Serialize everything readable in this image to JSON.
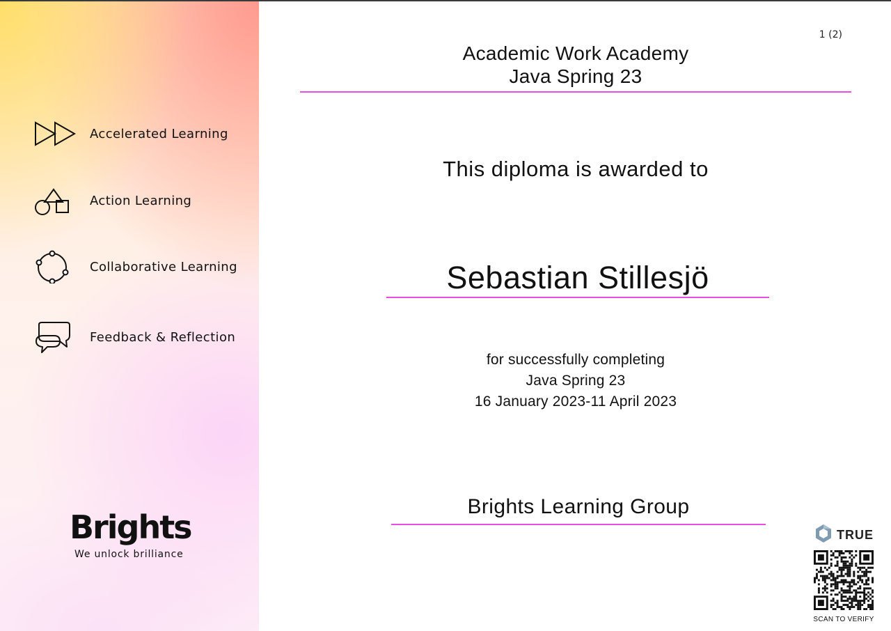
{
  "page_number": "1 (2)",
  "sidebar": {
    "features": [
      {
        "icon": "fast-forward-icon",
        "label": "Accelerated Learning"
      },
      {
        "icon": "shapes-icon",
        "label": "Action Learning"
      },
      {
        "icon": "circle-nodes-icon",
        "label": "Collaborative Learning"
      },
      {
        "icon": "speech-bubbles-icon",
        "label": "Feedback & Reflection"
      }
    ],
    "brand": "Brights",
    "tagline": "We unlock brilliance"
  },
  "diploma": {
    "academy": "Academic Work Academy",
    "program": "Java Spring 23",
    "awarded_text": "This diploma is awarded to",
    "recipient": "Sebastian Stillesjö",
    "completion_text": "for successfully completing",
    "course": "Java Spring 23",
    "dates": "16 January 2023-11 April 2023",
    "issuer": "Brights Learning Group"
  },
  "verification": {
    "brand": "TRUE",
    "scan_text": "SCAN TO VERIFY"
  },
  "colors": {
    "accent_rule": "#e94de3"
  }
}
